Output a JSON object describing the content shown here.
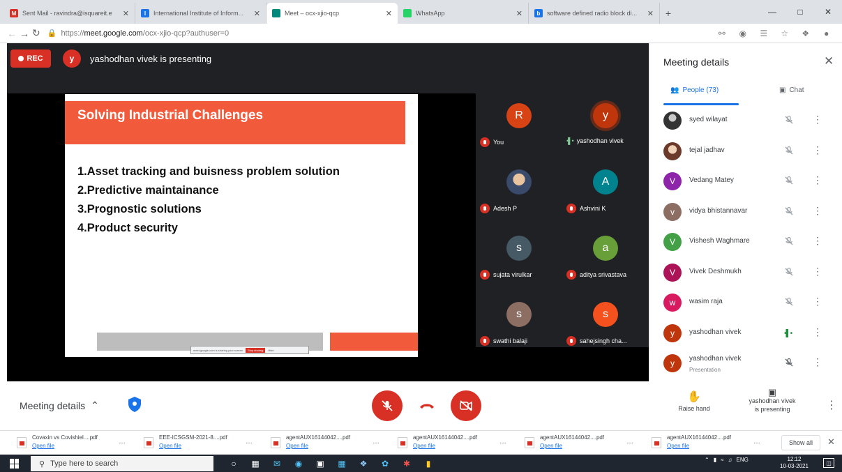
{
  "browser": {
    "tabs": [
      {
        "title": "Sent Mail - ravindra@isquareit.e",
        "favicon": "gmail-icon",
        "color": "#d93025",
        "letter": "M",
        "active": false
      },
      {
        "title": "International Institute of Inform...",
        "favicon": "site-icon",
        "color": "#1a73e8",
        "letter": "I",
        "active": false
      },
      {
        "title": "Meet – ocx-xjio-qcp",
        "favicon": "meet-icon",
        "color": "#00897b",
        "letter": "",
        "active": true
      },
      {
        "title": "WhatsApp",
        "favicon": "whatsapp-icon",
        "color": "#25d366",
        "letter": "",
        "active": false
      },
      {
        "title": "software defined radio block di...",
        "favicon": "bing-icon",
        "color": "#1a73e8",
        "letter": "b",
        "active": false
      }
    ],
    "url_prefix": "https://",
    "url_host": "meet.google.com",
    "url_path": "/ocx-xjio-qcp?authuser=0"
  },
  "meet": {
    "rec_label": "REC",
    "presenter_initial": "y",
    "presenter_text": "yashodhan vivek is presenting",
    "slide": {
      "title": "Solving Industrial Challenges",
      "items": [
        "1.Asset tracking and buisness problem solution",
        "2.Predictive maintainance",
        "3.Prognostic solutions",
        "4.Product security"
      ],
      "share_text": "meet.google.com is sharing your screen",
      "share_stop": "Stop sharing",
      "share_hide": "Hide"
    },
    "tiles": [
      {
        "initial": "R",
        "name": "You",
        "color": "#d84315",
        "status": "muted"
      },
      {
        "initial": "y",
        "name": "yashodhan vivek",
        "color": "#bf360c",
        "status": "speaking"
      },
      {
        "initial": "",
        "name": "Adesh P",
        "color": "#3a4a6a",
        "status": "muted",
        "photo": true
      },
      {
        "initial": "A",
        "name": "Ashvini K",
        "color": "#00838f",
        "status": "muted"
      },
      {
        "initial": "s",
        "name": "sujata virulkar",
        "color": "#455a64",
        "status": "muted"
      },
      {
        "initial": "a",
        "name": "aditya srivastava",
        "color": "#689f38",
        "status": "muted"
      },
      {
        "initial": "s",
        "name": "swathi balaji",
        "color": "#8d6e63",
        "status": "muted"
      },
      {
        "initial": "s",
        "name": "sahejsingh cha...",
        "color": "#f4511e",
        "status": "muted"
      }
    ]
  },
  "panel": {
    "title": "Meeting details",
    "tab_people": "People (73)",
    "tab_chat": "Chat",
    "people": [
      {
        "name": "syed wilayat",
        "initial": "",
        "color": "#333333",
        "photo": "ph1",
        "status": "muted"
      },
      {
        "name": "tejal jadhav",
        "initial": "",
        "color": "#6b3a2a",
        "photo": "ph2",
        "status": "muted"
      },
      {
        "name": "Vedang Matey",
        "initial": "V",
        "color": "#8e24aa",
        "status": "muted"
      },
      {
        "name": "vidya bhistannavar",
        "initial": "v",
        "color": "#8d6e63",
        "status": "muted"
      },
      {
        "name": "Vishesh Waghmare",
        "initial": "V",
        "color": "#43a047",
        "status": "muted"
      },
      {
        "name": "Vivek Deshmukh",
        "initial": "V",
        "color": "#ad1457",
        "status": "muted"
      },
      {
        "name": "wasim raja",
        "initial": "w",
        "color": "#d81b60",
        "status": "muted"
      },
      {
        "name": "yashodhan vivek",
        "initial": "y",
        "color": "#bf360c",
        "status": "speaking"
      },
      {
        "name": "yashodhan vivek",
        "sub": "Presentation",
        "initial": "y",
        "color": "#bf360c",
        "status": "muted-dim"
      }
    ]
  },
  "controls": {
    "meeting_details": "Meeting details",
    "raise_hand": "Raise hand",
    "presenting_line1": "yashodhan vivek",
    "presenting_line2": "is presenting"
  },
  "downloads": {
    "items": [
      {
        "name": "Covaxin vs Covishiel....pdf",
        "open": "Open file"
      },
      {
        "name": "EEE-ICSGSM-2021-8....pdf",
        "open": "Open file"
      },
      {
        "name": "agentAUX16144042....pdf",
        "open": "Open file"
      },
      {
        "name": "agentAUX16144042....pdf",
        "open": "Open file"
      },
      {
        "name": "agentAUX16144042....pdf",
        "open": "Open file"
      },
      {
        "name": "agentAUX16144042....pdf",
        "open": "Open file"
      }
    ],
    "show_all": "Show all"
  },
  "taskbar": {
    "search_placeholder": "Type here to search",
    "lang": "ENG",
    "time": "12:12",
    "date": "10-03-2021"
  }
}
